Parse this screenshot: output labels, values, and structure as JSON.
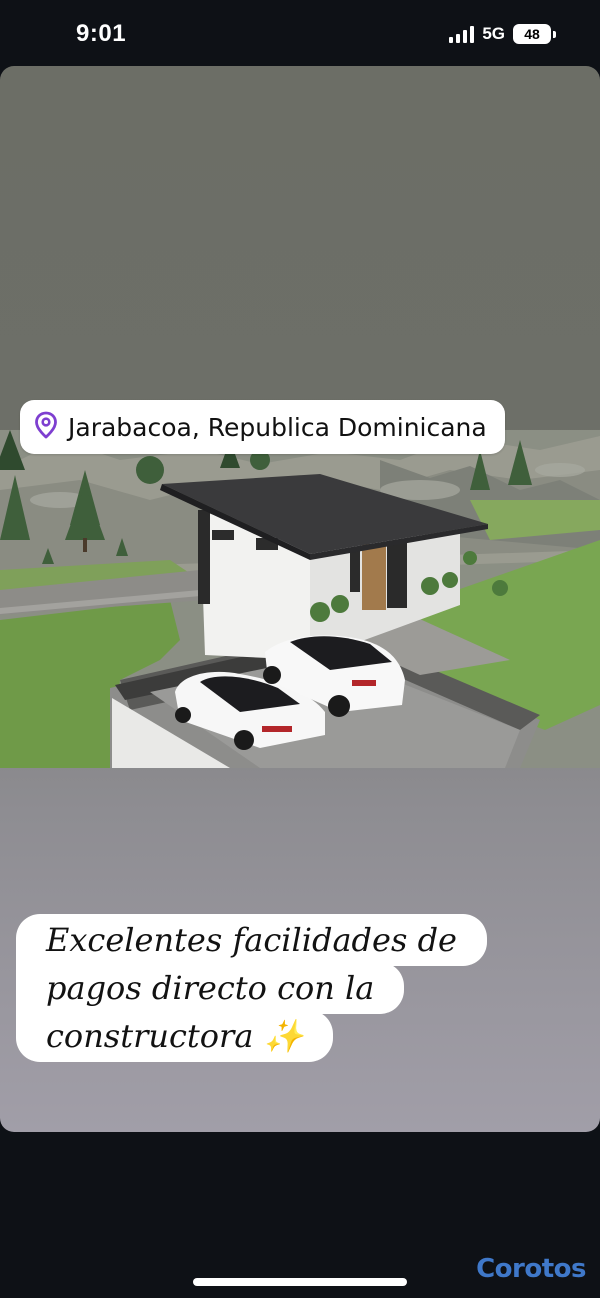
{
  "status_bar": {
    "time": "9:01",
    "network": "5G",
    "battery": "48"
  },
  "story": {
    "location": {
      "icon": "location-pin-icon",
      "text": "Jarabacoa, Republica Dominicana"
    },
    "caption_lines": [
      "Excelentes facilidades de",
      "pagos directo con la",
      "constructora ✨"
    ]
  },
  "brand": "Corotos",
  "colors": {
    "location_icon": "#7e3fd0",
    "brand": "#3f78c9"
  }
}
